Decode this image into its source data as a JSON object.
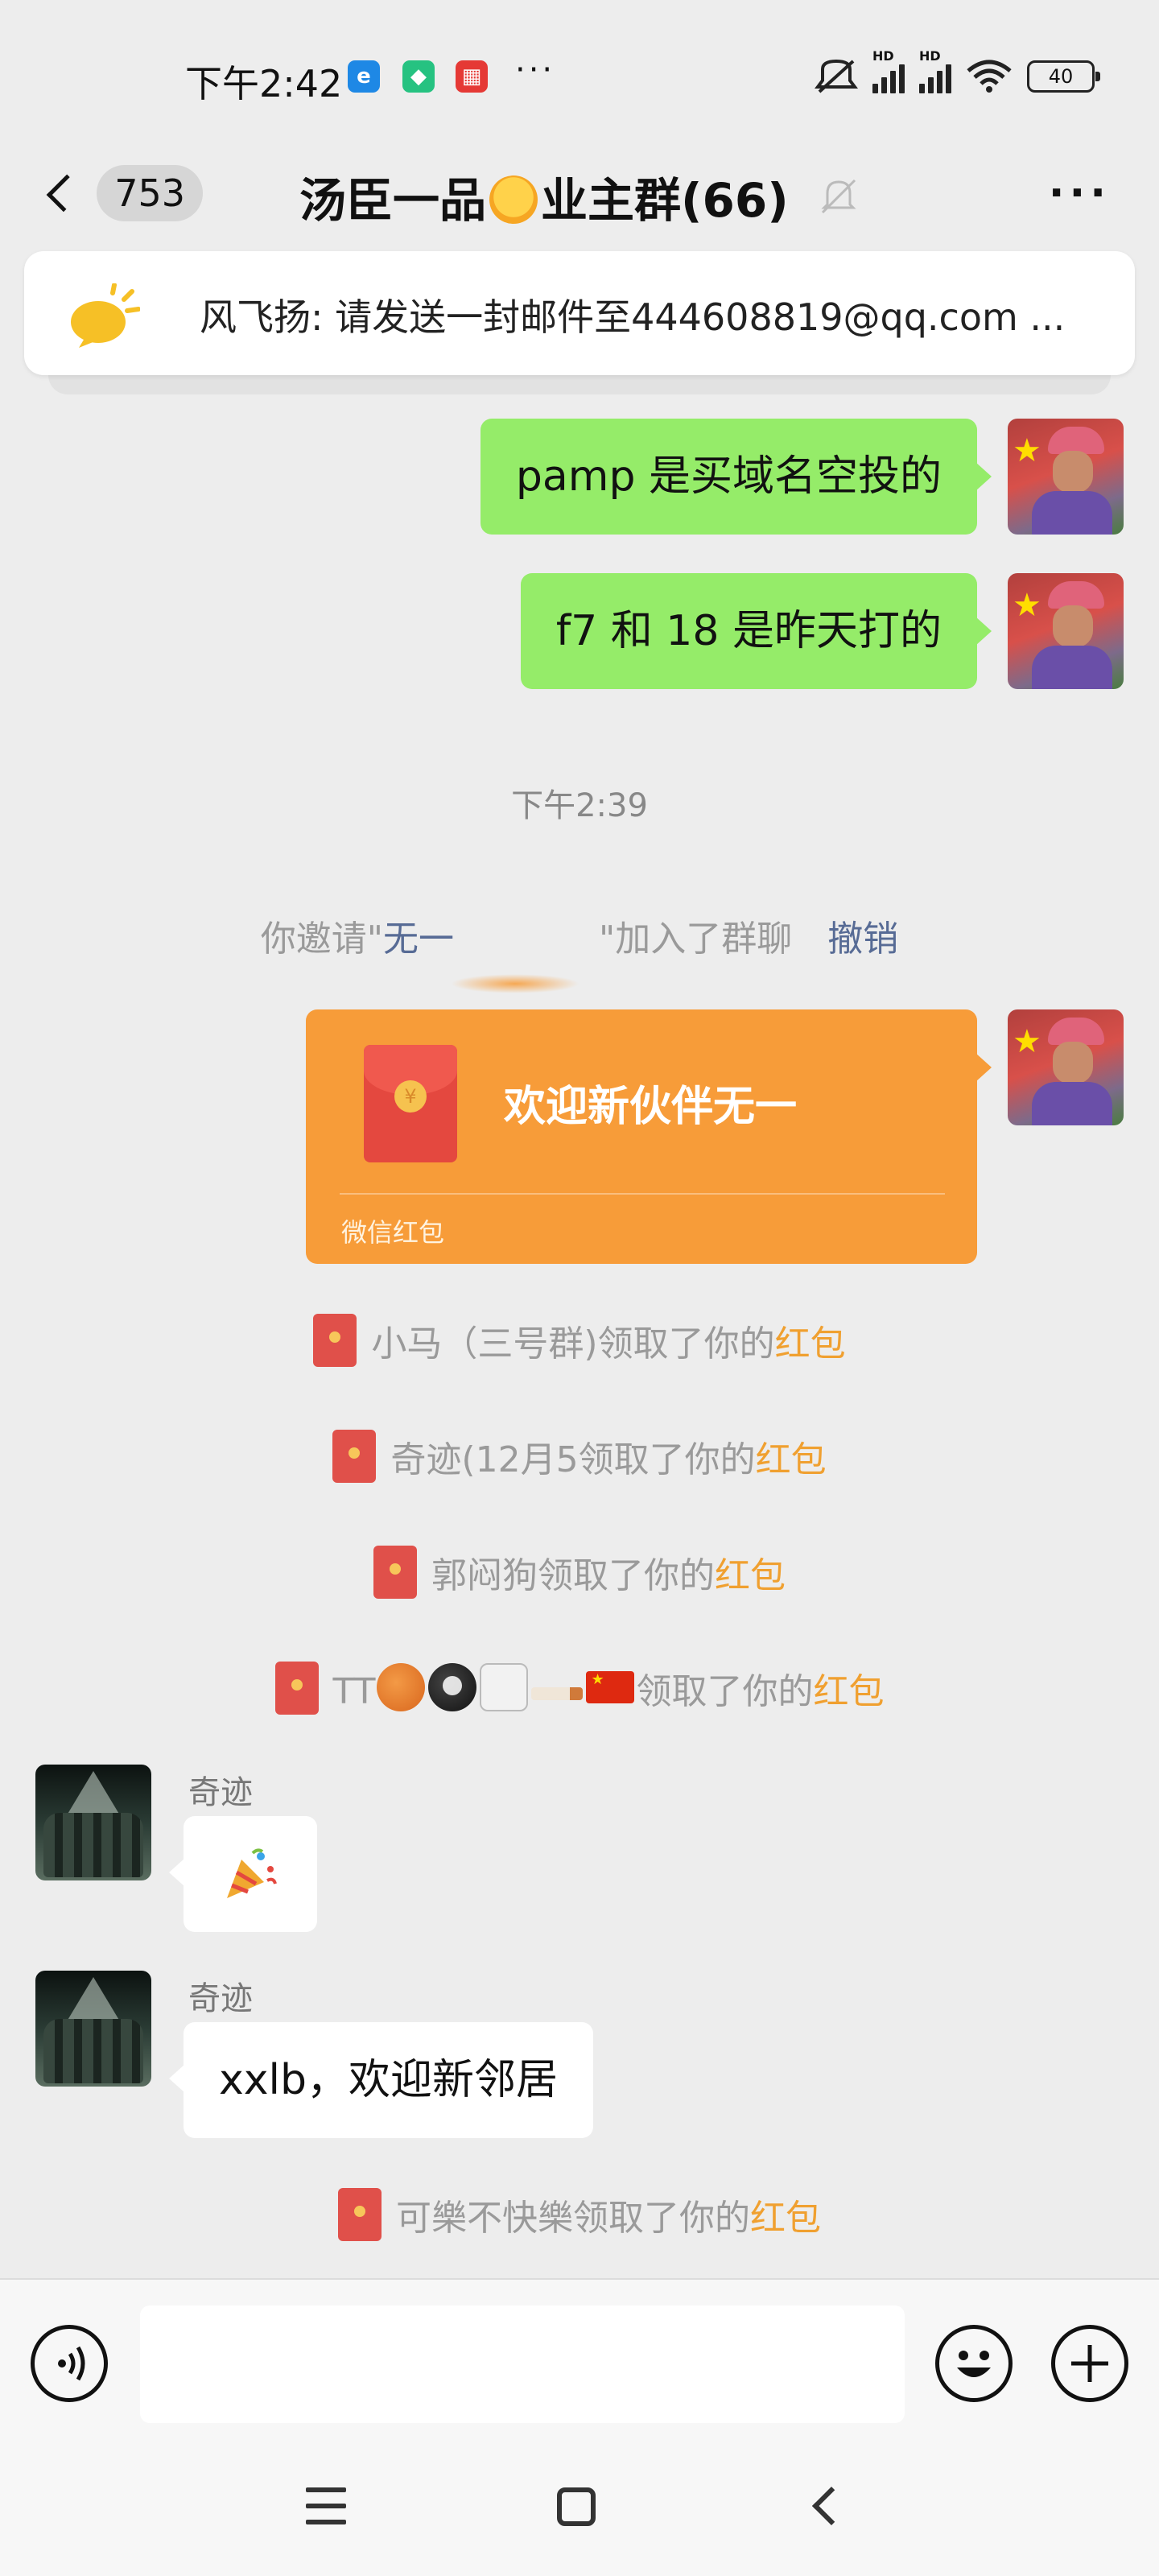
{
  "status_bar": {
    "time": "下午2:42",
    "overflow": "···",
    "battery": "40",
    "signal_1_label": "HD",
    "signal_2_label": "HD",
    "icons": [
      "browser-app-icon",
      "shield-app-icon",
      "calendar-app-icon",
      "mute-vibrate-icon",
      "signal-icon",
      "signal-icon",
      "wifi-icon",
      "battery-icon"
    ],
    "app_icon_colors": [
      "#1e88e5",
      "#26c281",
      "#e53935"
    ]
  },
  "header": {
    "unread_count": "753",
    "title_prefix": "汤臣一品",
    "title_suffix": "业主群(66)",
    "more": "···"
  },
  "pinned_notice": {
    "text": "风飞扬: 请发送一封邮件至444608819@qq.com ..."
  },
  "messages": {
    "m1": "pamp 是买域名空投的",
    "m2": "f7 和 18 是昨天打的",
    "timestamp": "下午2:39",
    "invite_prefix": "你邀请\"",
    "invite_name": "无一",
    "invite_suffix": "\"加入了群聊",
    "invite_undo": "撤销",
    "red_packet_title": "欢迎新伙伴无一",
    "red_packet_label": "微信红包",
    "claim_1_name": "小马（三号群)领取了你的",
    "claim_2_name": "奇迹(12月5领取了你的",
    "claim_3_name": "郭闷狗领取了你的",
    "claim_4_name_prefix": "TT",
    "claim_4_suffix": "领取了你的",
    "claim_5_name": "可樂不快樂领取了你的",
    "red_packet_word": "红包",
    "sender_1": "奇迹",
    "sender_2": "奇迹",
    "m_welcome": "xxlb，欢迎新邻居"
  },
  "colors": {
    "my_bubble": "#95ec69",
    "their_bubble": "#ffffff",
    "red_packet": "#f79c39",
    "link": "#576b95",
    "red_packet_text": "#f0a030",
    "background": "#ededed"
  },
  "input_bar": {
    "placeholder": ""
  }
}
